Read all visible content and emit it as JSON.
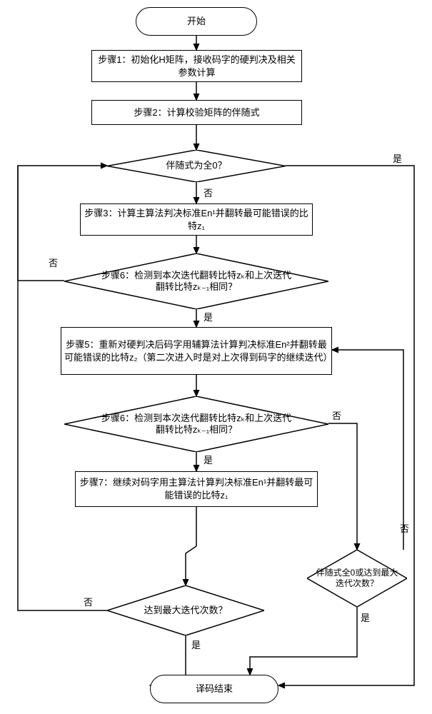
{
  "terminators": {
    "start": "开始",
    "end": "译码结束"
  },
  "process": {
    "step1": "步骤1：初始化H矩阵，接收码字的硬判决及相关参数计算",
    "step2": "步骤2：计算校验矩阵的伴随式",
    "step3": "步骤3：计算主算法判决标准En¹并翻转最可能错误的比特z₁",
    "step5": "步骤5：重新对硬判决后码字用辅算法计算判决标准En²并翻转最可能错误的比特z₂（第二次进入时是对上次得到码字的继续迭代）",
    "step7": "步骤7：继续对码字用主算法计算判决标准En¹并翻转最可能错误的比特z₁"
  },
  "decision": {
    "d1": "伴随式为全0？",
    "d2_step6a": "步骤6：检测到本次迭代翻转比特zₖ和上次迭代翻转比特zₖ₋₁相同？",
    "d3_step6b": "步骤6：检测到本次迭代翻转比特zₖ和上次迭代翻转比特zₖ₋₁相同？",
    "d4_maxiter": "达到最大迭代次数？",
    "d5_syndrome_or_max": "伴随式全0或达到最大迭代次数？"
  },
  "labels": {
    "yes": "是",
    "no": "否"
  },
  "chart_data": {
    "type": "flowchart",
    "nodes": [
      {
        "id": "start",
        "type": "terminator",
        "text": "开始"
      },
      {
        "id": "p1",
        "type": "process",
        "text": "步骤1：初始化H矩阵，接收码字的硬判决及相关参数计算"
      },
      {
        "id": "p2",
        "type": "process",
        "text": "步骤2：计算校验矩阵的伴随式"
      },
      {
        "id": "d1",
        "type": "decision",
        "text": "伴随式为全0？"
      },
      {
        "id": "p3",
        "type": "process",
        "text": "步骤3：计算主算法判决标准En¹并翻转最可能错误的比特z₁"
      },
      {
        "id": "d2",
        "type": "decision",
        "text": "步骤6：检测到本次迭代翻转比特zₖ和上次迭代翻转比特zₖ₋₁相同？"
      },
      {
        "id": "p5",
        "type": "process",
        "text": "步骤5：重新对硬判决后码字用辅算法计算判决标准En²并翻转最可能错误的比特z₂（第二次进入时是对上次得到码字的继续迭代）"
      },
      {
        "id": "d3",
        "type": "decision",
        "text": "步骤6：检测到本次迭代翻转比特zₖ和上次迭代翻转比特zₖ₋₁相同？"
      },
      {
        "id": "p7",
        "type": "process",
        "text": "步骤7：继续对码字用主算法计算判决标准En¹并翻转最可能错误的比特z₁"
      },
      {
        "id": "d5",
        "type": "decision",
        "text": "伴随式全0或达到最大迭代次数？"
      },
      {
        "id": "d4",
        "type": "decision",
        "text": "达到最大迭代次数？"
      },
      {
        "id": "end",
        "type": "terminator",
        "text": "译码结束"
      }
    ],
    "edges": [
      {
        "from": "start",
        "to": "p1"
      },
      {
        "from": "p1",
        "to": "p2"
      },
      {
        "from": "p2",
        "to": "d1"
      },
      {
        "from": "d1",
        "to": "end",
        "label": "是"
      },
      {
        "from": "d1",
        "to": "p3",
        "label": "否"
      },
      {
        "from": "p3",
        "to": "d2"
      },
      {
        "from": "d2",
        "to": "d1",
        "label": "否"
      },
      {
        "from": "d2",
        "to": "p5",
        "label": "是"
      },
      {
        "from": "p5",
        "to": "d3"
      },
      {
        "from": "d3",
        "to": "p7",
        "label": "是"
      },
      {
        "from": "d3",
        "to": "d5",
        "label": "否"
      },
      {
        "from": "d5",
        "to": "p5",
        "label": "否"
      },
      {
        "from": "d5",
        "to": "end",
        "label": "是"
      },
      {
        "from": "p7",
        "to": "d4"
      },
      {
        "from": "d4",
        "to": "d1",
        "label": "否"
      },
      {
        "from": "d4",
        "to": "end",
        "label": "是"
      }
    ]
  }
}
